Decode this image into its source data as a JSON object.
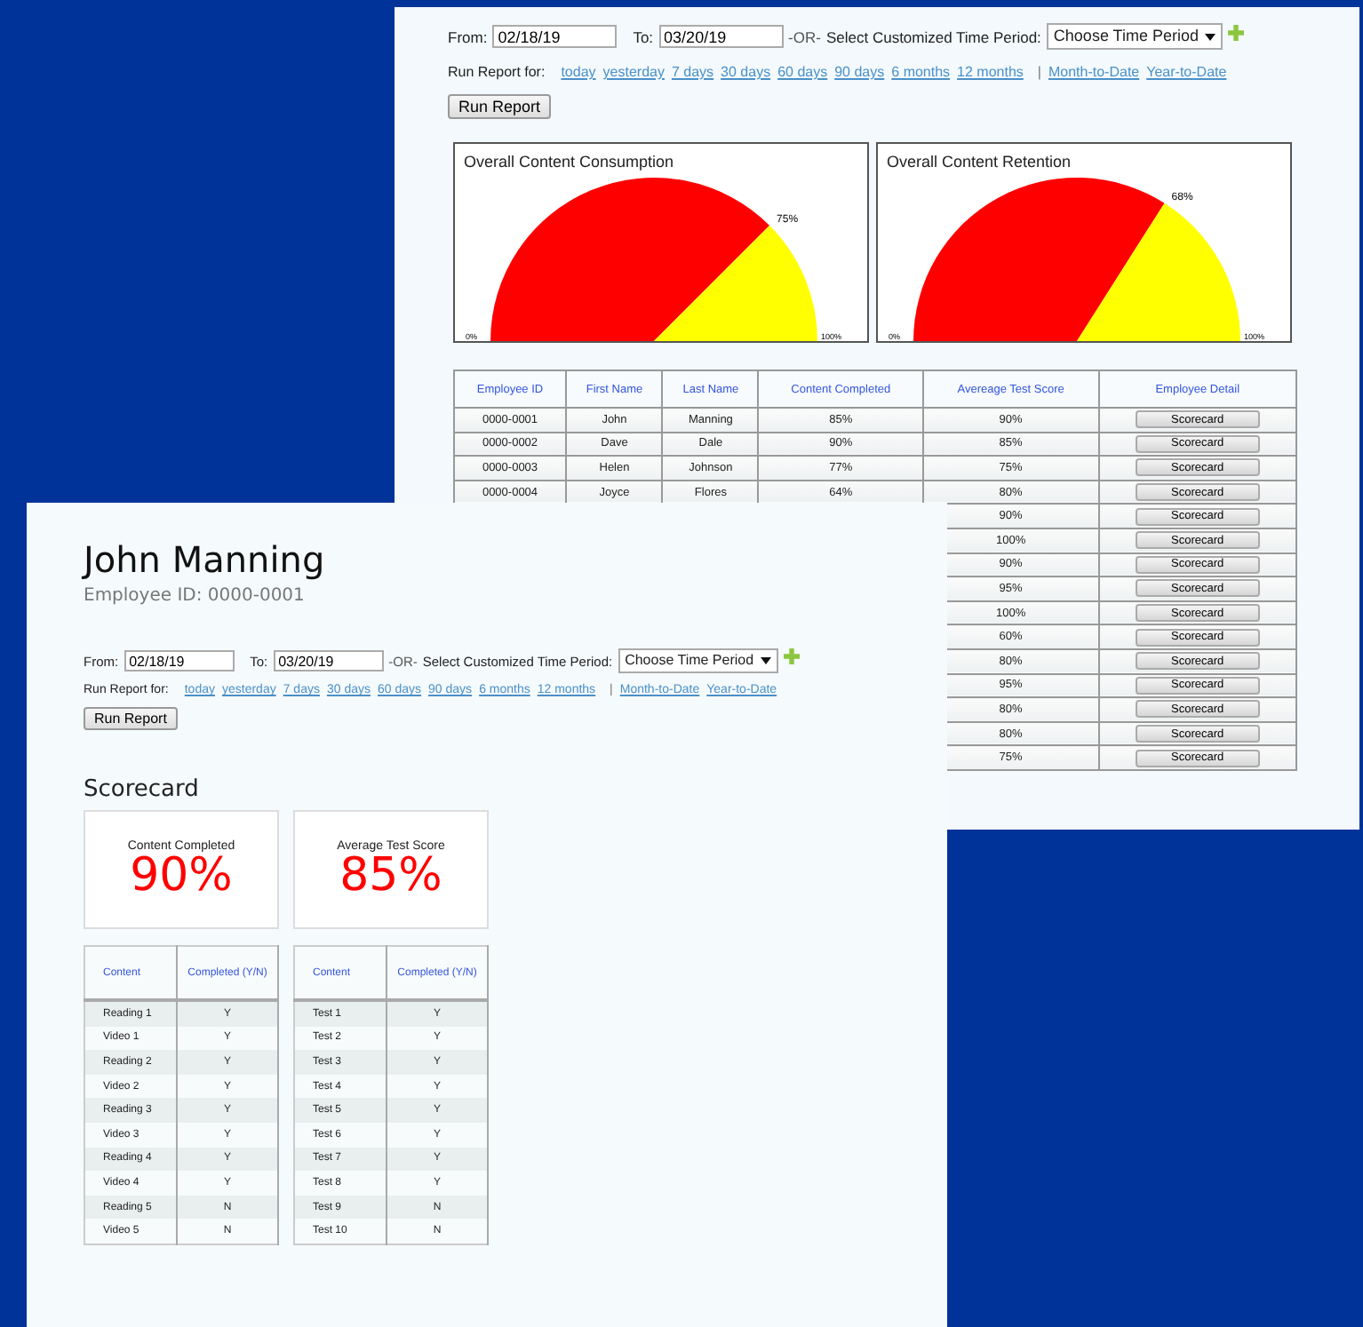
{
  "report_window": {
    "date_filter": {
      "from_label": "From:",
      "from_value": "02/18/19",
      "to_label": "To:",
      "to_value": "03/20/19",
      "or_label": "-OR-",
      "period_label": "Select Customized Time Period:",
      "period_value": "Choose Time Period"
    },
    "quick_ranges": {
      "label": "Run Report for:",
      "links": [
        "today",
        "yesterday",
        "7 days",
        "30 days",
        "60 days",
        "90 days",
        "6 months",
        "12 months"
      ],
      "separator": "|",
      "extra_links": [
        "Month-to-Date",
        "Year-to-Date"
      ]
    },
    "run_button": "Run Report",
    "gauges": [
      {
        "chart_data": {
          "type": "pie",
          "title": "Overall Content Consumption",
          "values": [
            75,
            25
          ],
          "annotations": [
            "0%",
            "75%",
            "100%"
          ]
        }
      },
      {
        "chart_data": {
          "type": "pie",
          "title": "Overall Content Retention",
          "values": [
            68,
            32
          ],
          "annotations": [
            "0%",
            "68%",
            "100%"
          ]
        }
      }
    ],
    "table": {
      "columns": [
        "Employee ID",
        "First Name",
        "Last Name",
        "Content Completed",
        "Avereage Test Score",
        "Employee Detail"
      ],
      "rows": [
        {
          "employee_id": "0000-0001",
          "first_name": "John",
          "last_name": "Manning",
          "content_completed": "85%",
          "average_test_score": "90%",
          "detail_button": "Scorecard"
        },
        {
          "employee_id": "0000-0002",
          "first_name": "Dave",
          "last_name": "Dale",
          "content_completed": "90%",
          "average_test_score": "85%",
          "detail_button": "Scorecard"
        },
        {
          "employee_id": "0000-0003",
          "first_name": "Helen",
          "last_name": "Johnson",
          "content_completed": "77%",
          "average_test_score": "75%",
          "detail_button": "Scorecard"
        },
        {
          "employee_id": "0000-0004",
          "first_name": "Joyce",
          "last_name": "Flores",
          "content_completed": "64%",
          "average_test_score": "80%",
          "detail_button": "Scorecard"
        },
        {
          "average_test_score": "90%",
          "detail_button": "Scorecard"
        },
        {
          "average_test_score": "100%",
          "detail_button": "Scorecard"
        },
        {
          "average_test_score": "90%",
          "detail_button": "Scorecard"
        },
        {
          "average_test_score": "95%",
          "detail_button": "Scorecard"
        },
        {
          "average_test_score": "100%",
          "detail_button": "Scorecard"
        },
        {
          "average_test_score": "60%",
          "detail_button": "Scorecard"
        },
        {
          "average_test_score": "80%",
          "detail_button": "Scorecard"
        },
        {
          "average_test_score": "95%",
          "detail_button": "Scorecard"
        },
        {
          "average_test_score": "80%",
          "detail_button": "Scorecard"
        },
        {
          "average_test_score": "80%",
          "detail_button": "Scorecard"
        },
        {
          "average_test_score": "75%",
          "detail_button": "Scorecard"
        }
      ]
    }
  },
  "employee_window": {
    "name": "John Manning",
    "employee_id": "Employee ID: 0000-0001",
    "date_filter": {
      "from_label": "From:",
      "from_value": "02/18/19",
      "to_label": "To:",
      "to_value": "03/20/19",
      "or_label": "-OR-",
      "period_label": "Select Customized Time Period:",
      "period_value": "Choose Time Period"
    },
    "quick_ranges": {
      "label": "Run Report for:",
      "links": [
        "today",
        "yesterday",
        "7 days",
        "30 days",
        "60 days",
        "90 days",
        "6 months",
        "12 months"
      ],
      "separator": "|",
      "extra_links": [
        "Month-to-Date",
        "Year-to-Date"
      ]
    },
    "run_button": "Run Report",
    "scorecard_title": "Scorecard",
    "stats": [
      {
        "label": "Content Completed",
        "value": "90%"
      },
      {
        "label": "Average Test Score",
        "value": "85%"
      }
    ],
    "tables": [
      {
        "columns": [
          "Content",
          "Completed (Y/N)"
        ],
        "rows": [
          [
            "Reading 1",
            "Y"
          ],
          [
            "Video 1",
            "Y"
          ],
          [
            "Reading 2",
            "Y"
          ],
          [
            "Video 2",
            "Y"
          ],
          [
            "Reading 3",
            "Y"
          ],
          [
            "Video 3",
            "Y"
          ],
          [
            "Reading 4",
            "Y"
          ],
          [
            "Video 4",
            "Y"
          ],
          [
            "Reading 5",
            "N"
          ],
          [
            "Video 5",
            "N"
          ]
        ]
      },
      {
        "columns": [
          "Content",
          "Completed (Y/N)"
        ],
        "rows": [
          [
            "Test 1",
            "Y"
          ],
          [
            "Test 2",
            "Y"
          ],
          [
            "Test 3",
            "Y"
          ],
          [
            "Test 4",
            "Y"
          ],
          [
            "Test 5",
            "Y"
          ],
          [
            "Test 6",
            "Y"
          ],
          [
            "Test 7",
            "Y"
          ],
          [
            "Test 8",
            "Y"
          ],
          [
            "Test 9",
            "N"
          ],
          [
            "Test 10",
            "N"
          ]
        ]
      }
    ]
  }
}
